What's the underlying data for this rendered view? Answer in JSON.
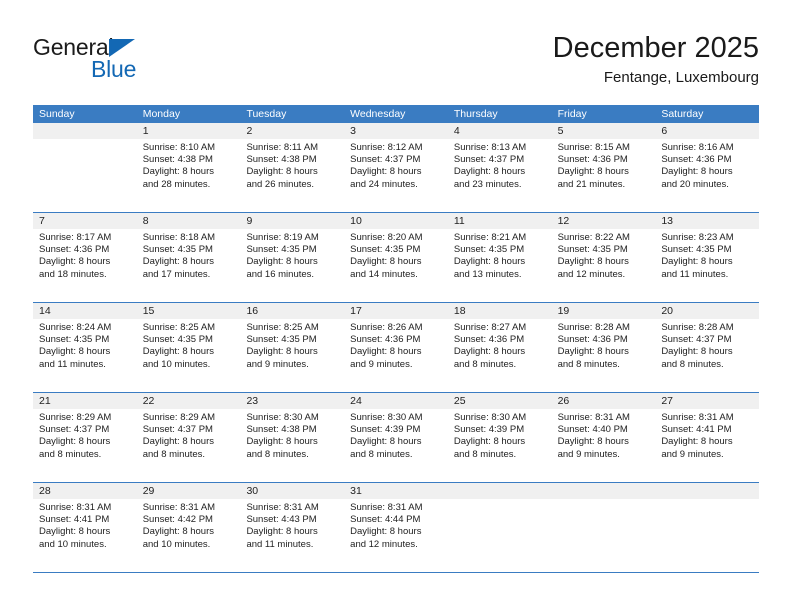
{
  "brand": {
    "name_part1": "General",
    "name_part2": "Blue",
    "triangle_color": "#1368b4"
  },
  "header": {
    "title": "December 2025",
    "subtitle": "Fentange, Luxembourg"
  },
  "theme": {
    "header_bg": "#3a7cc2",
    "header_text": "#ffffff",
    "numband_bg": "#f0f0f0",
    "grid_line": "#3a7cc2",
    "body_text": "#222222"
  },
  "weekdays": [
    "Sunday",
    "Monday",
    "Tuesday",
    "Wednesday",
    "Thursday",
    "Friday",
    "Saturday"
  ],
  "weeks": [
    [
      {
        "day": "",
        "sunrise": "",
        "sunset": "",
        "daylight_line1": "",
        "daylight_line2": ""
      },
      {
        "day": "1",
        "sunrise": "Sunrise: 8:10 AM",
        "sunset": "Sunset: 4:38 PM",
        "daylight_line1": "Daylight: 8 hours",
        "daylight_line2": "and 28 minutes."
      },
      {
        "day": "2",
        "sunrise": "Sunrise: 8:11 AM",
        "sunset": "Sunset: 4:38 PM",
        "daylight_line1": "Daylight: 8 hours",
        "daylight_line2": "and 26 minutes."
      },
      {
        "day": "3",
        "sunrise": "Sunrise: 8:12 AM",
        "sunset": "Sunset: 4:37 PM",
        "daylight_line1": "Daylight: 8 hours",
        "daylight_line2": "and 24 minutes."
      },
      {
        "day": "4",
        "sunrise": "Sunrise: 8:13 AM",
        "sunset": "Sunset: 4:37 PM",
        "daylight_line1": "Daylight: 8 hours",
        "daylight_line2": "and 23 minutes."
      },
      {
        "day": "5",
        "sunrise": "Sunrise: 8:15 AM",
        "sunset": "Sunset: 4:36 PM",
        "daylight_line1": "Daylight: 8 hours",
        "daylight_line2": "and 21 minutes."
      },
      {
        "day": "6",
        "sunrise": "Sunrise: 8:16 AM",
        "sunset": "Sunset: 4:36 PM",
        "daylight_line1": "Daylight: 8 hours",
        "daylight_line2": "and 20 minutes."
      }
    ],
    [
      {
        "day": "7",
        "sunrise": "Sunrise: 8:17 AM",
        "sunset": "Sunset: 4:36 PM",
        "daylight_line1": "Daylight: 8 hours",
        "daylight_line2": "and 18 minutes."
      },
      {
        "day": "8",
        "sunrise": "Sunrise: 8:18 AM",
        "sunset": "Sunset: 4:35 PM",
        "daylight_line1": "Daylight: 8 hours",
        "daylight_line2": "and 17 minutes."
      },
      {
        "day": "9",
        "sunrise": "Sunrise: 8:19 AM",
        "sunset": "Sunset: 4:35 PM",
        "daylight_line1": "Daylight: 8 hours",
        "daylight_line2": "and 16 minutes."
      },
      {
        "day": "10",
        "sunrise": "Sunrise: 8:20 AM",
        "sunset": "Sunset: 4:35 PM",
        "daylight_line1": "Daylight: 8 hours",
        "daylight_line2": "and 14 minutes."
      },
      {
        "day": "11",
        "sunrise": "Sunrise: 8:21 AM",
        "sunset": "Sunset: 4:35 PM",
        "daylight_line1": "Daylight: 8 hours",
        "daylight_line2": "and 13 minutes."
      },
      {
        "day": "12",
        "sunrise": "Sunrise: 8:22 AM",
        "sunset": "Sunset: 4:35 PM",
        "daylight_line1": "Daylight: 8 hours",
        "daylight_line2": "and 12 minutes."
      },
      {
        "day": "13",
        "sunrise": "Sunrise: 8:23 AM",
        "sunset": "Sunset: 4:35 PM",
        "daylight_line1": "Daylight: 8 hours",
        "daylight_line2": "and 11 minutes."
      }
    ],
    [
      {
        "day": "14",
        "sunrise": "Sunrise: 8:24 AM",
        "sunset": "Sunset: 4:35 PM",
        "daylight_line1": "Daylight: 8 hours",
        "daylight_line2": "and 11 minutes."
      },
      {
        "day": "15",
        "sunrise": "Sunrise: 8:25 AM",
        "sunset": "Sunset: 4:35 PM",
        "daylight_line1": "Daylight: 8 hours",
        "daylight_line2": "and 10 minutes."
      },
      {
        "day": "16",
        "sunrise": "Sunrise: 8:25 AM",
        "sunset": "Sunset: 4:35 PM",
        "daylight_line1": "Daylight: 8 hours",
        "daylight_line2": "and 9 minutes."
      },
      {
        "day": "17",
        "sunrise": "Sunrise: 8:26 AM",
        "sunset": "Sunset: 4:36 PM",
        "daylight_line1": "Daylight: 8 hours",
        "daylight_line2": "and 9 minutes."
      },
      {
        "day": "18",
        "sunrise": "Sunrise: 8:27 AM",
        "sunset": "Sunset: 4:36 PM",
        "daylight_line1": "Daylight: 8 hours",
        "daylight_line2": "and 8 minutes."
      },
      {
        "day": "19",
        "sunrise": "Sunrise: 8:28 AM",
        "sunset": "Sunset: 4:36 PM",
        "daylight_line1": "Daylight: 8 hours",
        "daylight_line2": "and 8 minutes."
      },
      {
        "day": "20",
        "sunrise": "Sunrise: 8:28 AM",
        "sunset": "Sunset: 4:37 PM",
        "daylight_line1": "Daylight: 8 hours",
        "daylight_line2": "and 8 minutes."
      }
    ],
    [
      {
        "day": "21",
        "sunrise": "Sunrise: 8:29 AM",
        "sunset": "Sunset: 4:37 PM",
        "daylight_line1": "Daylight: 8 hours",
        "daylight_line2": "and 8 minutes."
      },
      {
        "day": "22",
        "sunrise": "Sunrise: 8:29 AM",
        "sunset": "Sunset: 4:37 PM",
        "daylight_line1": "Daylight: 8 hours",
        "daylight_line2": "and 8 minutes."
      },
      {
        "day": "23",
        "sunrise": "Sunrise: 8:30 AM",
        "sunset": "Sunset: 4:38 PM",
        "daylight_line1": "Daylight: 8 hours",
        "daylight_line2": "and 8 minutes."
      },
      {
        "day": "24",
        "sunrise": "Sunrise: 8:30 AM",
        "sunset": "Sunset: 4:39 PM",
        "daylight_line1": "Daylight: 8 hours",
        "daylight_line2": "and 8 minutes."
      },
      {
        "day": "25",
        "sunrise": "Sunrise: 8:30 AM",
        "sunset": "Sunset: 4:39 PM",
        "daylight_line1": "Daylight: 8 hours",
        "daylight_line2": "and 8 minutes."
      },
      {
        "day": "26",
        "sunrise": "Sunrise: 8:31 AM",
        "sunset": "Sunset: 4:40 PM",
        "daylight_line1": "Daylight: 8 hours",
        "daylight_line2": "and 9 minutes."
      },
      {
        "day": "27",
        "sunrise": "Sunrise: 8:31 AM",
        "sunset": "Sunset: 4:41 PM",
        "daylight_line1": "Daylight: 8 hours",
        "daylight_line2": "and 9 minutes."
      }
    ],
    [
      {
        "day": "28",
        "sunrise": "Sunrise: 8:31 AM",
        "sunset": "Sunset: 4:41 PM",
        "daylight_line1": "Daylight: 8 hours",
        "daylight_line2": "and 10 minutes."
      },
      {
        "day": "29",
        "sunrise": "Sunrise: 8:31 AM",
        "sunset": "Sunset: 4:42 PM",
        "daylight_line1": "Daylight: 8 hours",
        "daylight_line2": "and 10 minutes."
      },
      {
        "day": "30",
        "sunrise": "Sunrise: 8:31 AM",
        "sunset": "Sunset: 4:43 PM",
        "daylight_line1": "Daylight: 8 hours",
        "daylight_line2": "and 11 minutes."
      },
      {
        "day": "31",
        "sunrise": "Sunrise: 8:31 AM",
        "sunset": "Sunset: 4:44 PM",
        "daylight_line1": "Daylight: 8 hours",
        "daylight_line2": "and 12 minutes."
      },
      {
        "day": "",
        "sunrise": "",
        "sunset": "",
        "daylight_line1": "",
        "daylight_line2": ""
      },
      {
        "day": "",
        "sunrise": "",
        "sunset": "",
        "daylight_line1": "",
        "daylight_line2": ""
      },
      {
        "day": "",
        "sunrise": "",
        "sunset": "",
        "daylight_line1": "",
        "daylight_line2": ""
      }
    ]
  ]
}
